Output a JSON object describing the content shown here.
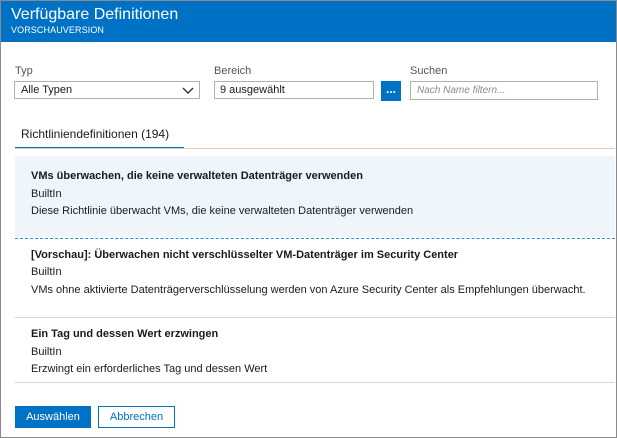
{
  "window": {
    "title": "Verfügbare Definitionen",
    "subtitle": "VORSCHAUVERSION"
  },
  "filters": {
    "type_label": "Typ",
    "type_value": "Alle Typen",
    "scope_label": "Bereich",
    "scope_value": "9 ausgewählt",
    "scope_button": "...",
    "search_label": "Suchen",
    "search_placeholder": "Nach Name filtern..."
  },
  "tabs": [
    {
      "label": "Richtliniendefinitionen (194)",
      "active": true
    }
  ],
  "definitions": [
    {
      "name": "VMs überwachen, die keine verwalteten Datenträger verwenden",
      "type": "BuiltIn",
      "description": "Diese Richtlinie überwacht VMs, die keine verwalteten Datenträger verwenden",
      "selected": true
    },
    {
      "name": "[Vorschau]: Überwachen nicht verschlüsselter VM-Datenträger im Security Center",
      "type": "BuiltIn",
      "description": "VMs ohne aktivierte Datenträgerverschlüsselung werden von Azure Security Center als Empfehlungen überwacht.",
      "selected": false
    },
    {
      "name": "Ein Tag und dessen Wert erzwingen",
      "type": "BuiltIn",
      "description": "Erzwingt ein erforderliches Tag und dessen Wert",
      "selected": false
    }
  ],
  "footer": {
    "select_label": "Auswählen",
    "cancel_label": "Abbrechen"
  },
  "colors": {
    "accent": "#0072c6",
    "selected_row": "#eef6fc",
    "header_text": "#ffffff"
  },
  "icons": {
    "dropdown": "chevron-down-icon"
  }
}
